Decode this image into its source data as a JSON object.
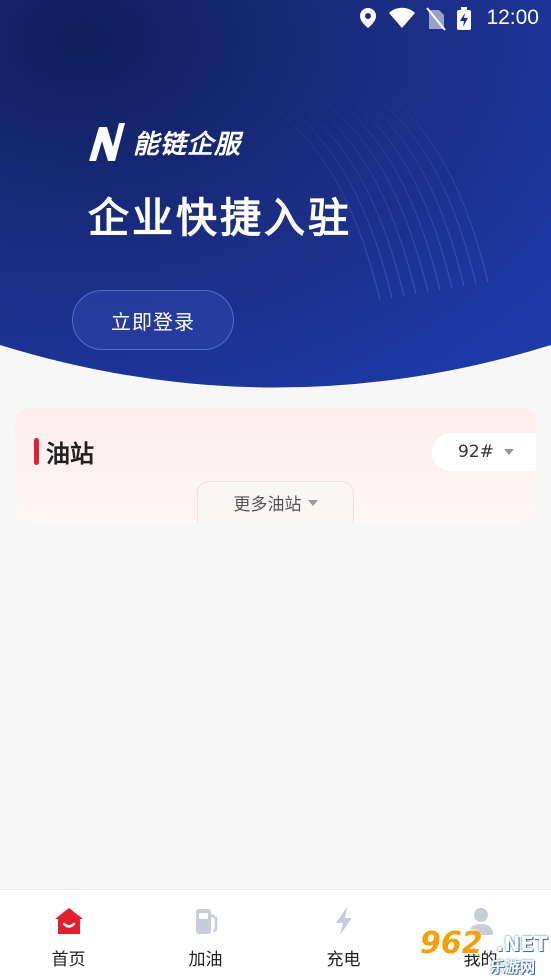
{
  "status_bar": {
    "time": "12:00",
    "icons": [
      "location-icon",
      "wifi-icon",
      "no-sim-icon",
      "battery-charging-icon"
    ]
  },
  "hero": {
    "brand_name": "能链企服",
    "logo": "n-logo-icon",
    "title": "企业快捷入驻",
    "login_button": "立即登录",
    "colors": {
      "deep": "#1a2a6b",
      "mid": "#1e3aa0",
      "white_curve": "#f7f7f8"
    }
  },
  "stations": {
    "title": "油站",
    "fuel_type": "92#",
    "more_label": "更多油站",
    "accent": "#e51d2e"
  },
  "tabbar": {
    "tabs": [
      {
        "label": "首页",
        "icon": "home-icon",
        "active": true
      },
      {
        "label": "加油",
        "icon": "fuel-pump-icon",
        "active": false
      },
      {
        "label": "充电",
        "icon": "lightning-icon",
        "active": false
      },
      {
        "label": "我的",
        "icon": "user-icon",
        "active": false
      }
    ],
    "active_color": "#e51d2e",
    "inactive_icon_color": "#c8cdd8"
  },
  "watermark": {
    "number": "962",
    "domain": ".NET",
    "site_cn": "乐游网"
  }
}
